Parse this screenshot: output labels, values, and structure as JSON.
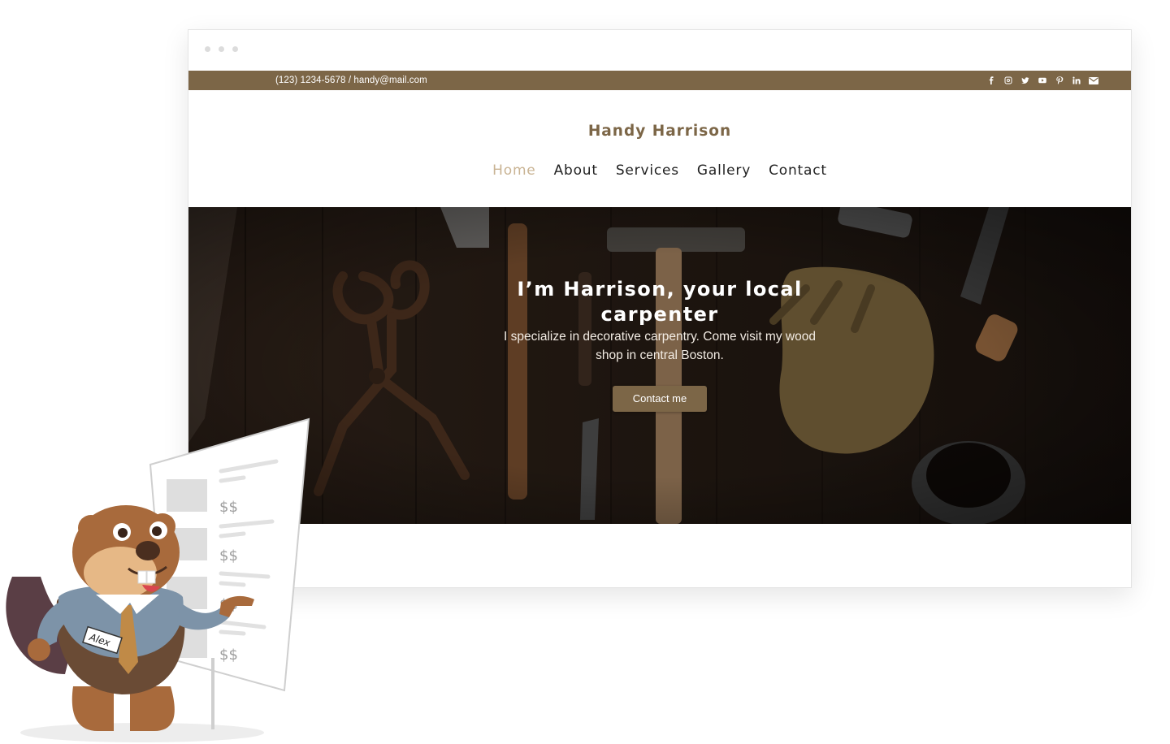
{
  "browser": {
    "window_controls": [
      "dot",
      "dot",
      "dot"
    ]
  },
  "topbar": {
    "contact": "(123) 1234-5678 / handy@mail.com",
    "socials": [
      "facebook-icon",
      "instagram-icon",
      "twitter-icon",
      "youtube-icon",
      "pinterest-icon",
      "linkedin-icon",
      "mail-icon"
    ]
  },
  "site": {
    "title": "Handy Harrison"
  },
  "nav": {
    "items": [
      {
        "label": "Home",
        "active": true
      },
      {
        "label": "About",
        "active": false
      },
      {
        "label": "Services",
        "active": false
      },
      {
        "label": "Gallery",
        "active": false
      },
      {
        "label": "Contact",
        "active": false
      }
    ]
  },
  "hero": {
    "title": "I’m Harrison, your local carpenter",
    "subtitle": "I specialize in decorative carpentry. Come visit my wood shop in central Boston.",
    "button": "Contact me"
  },
  "mascot": {
    "name_tag": "Alex",
    "sheet_labels": [
      "$$",
      "$$",
      "$$",
      "$$"
    ]
  },
  "colors": {
    "brand": "#7c6647",
    "nav_active": "#c9b393",
    "hero_bg": "#2a1e16"
  }
}
